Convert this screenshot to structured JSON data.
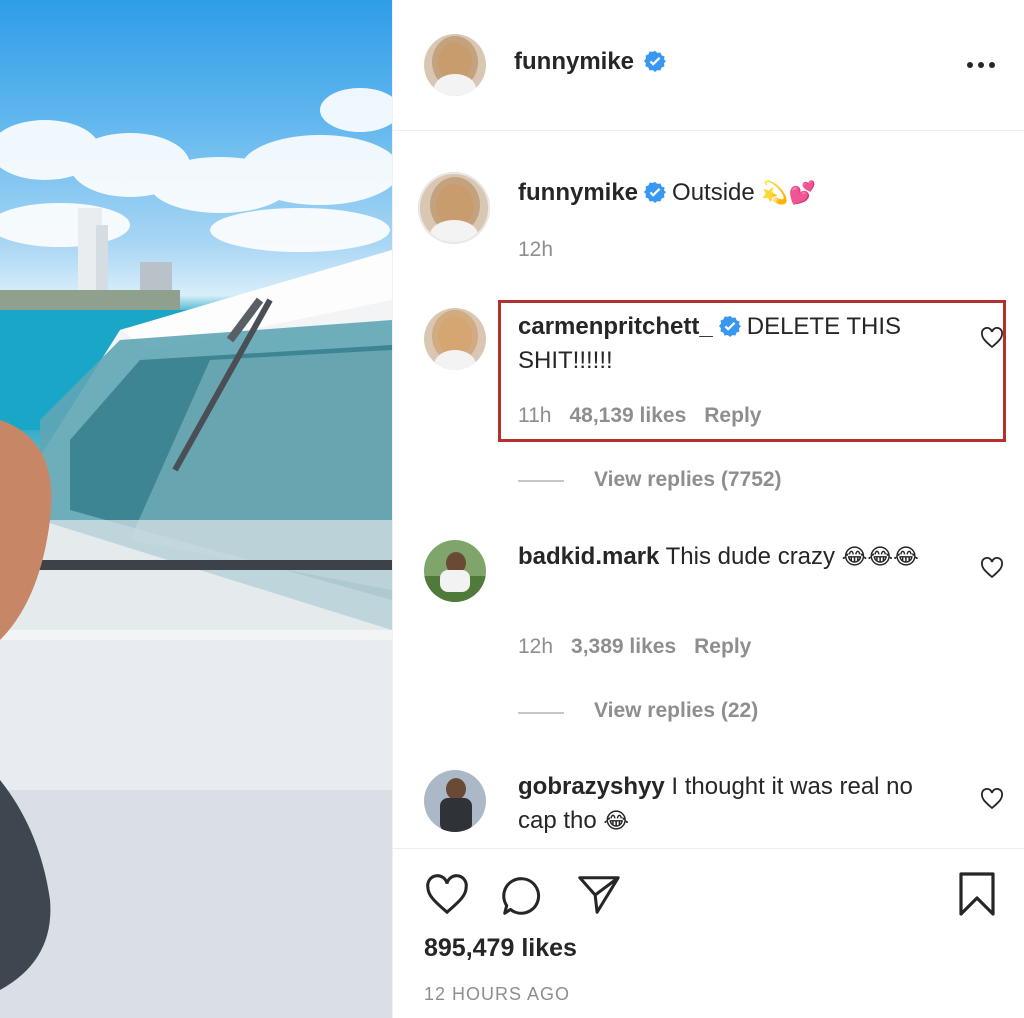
{
  "header": {
    "username": "funnymike",
    "more_icon": "ellipsis-icon"
  },
  "caption": {
    "username": "funnymike",
    "text": "Outside",
    "emoji": "💫💕",
    "time": "12h"
  },
  "comments": [
    {
      "username": "carmenpritchett_",
      "verified": true,
      "text": "DELETE THIS SHIT!!!!!!",
      "time": "11h",
      "likes": "48,139 likes",
      "reply": "Reply",
      "view_replies": "View replies (7752)"
    },
    {
      "username": "badkid.mark",
      "verified": false,
      "text": "This dude crazy",
      "emoji": "😂😂😂",
      "time": "12h",
      "likes": "3,389 likes",
      "reply": "Reply",
      "view_replies": "View replies (22)"
    },
    {
      "username": "gobrazyshyy",
      "verified": false,
      "text": "I thought it was real no cap tho",
      "emoji": "😂"
    }
  ],
  "footer": {
    "likes": "895,479 likes",
    "timestamp": "12 HOURS AGO"
  },
  "colors": {
    "verified": "#3897f0",
    "highlight": "#b2302e",
    "muted": "#8e8e8e"
  }
}
